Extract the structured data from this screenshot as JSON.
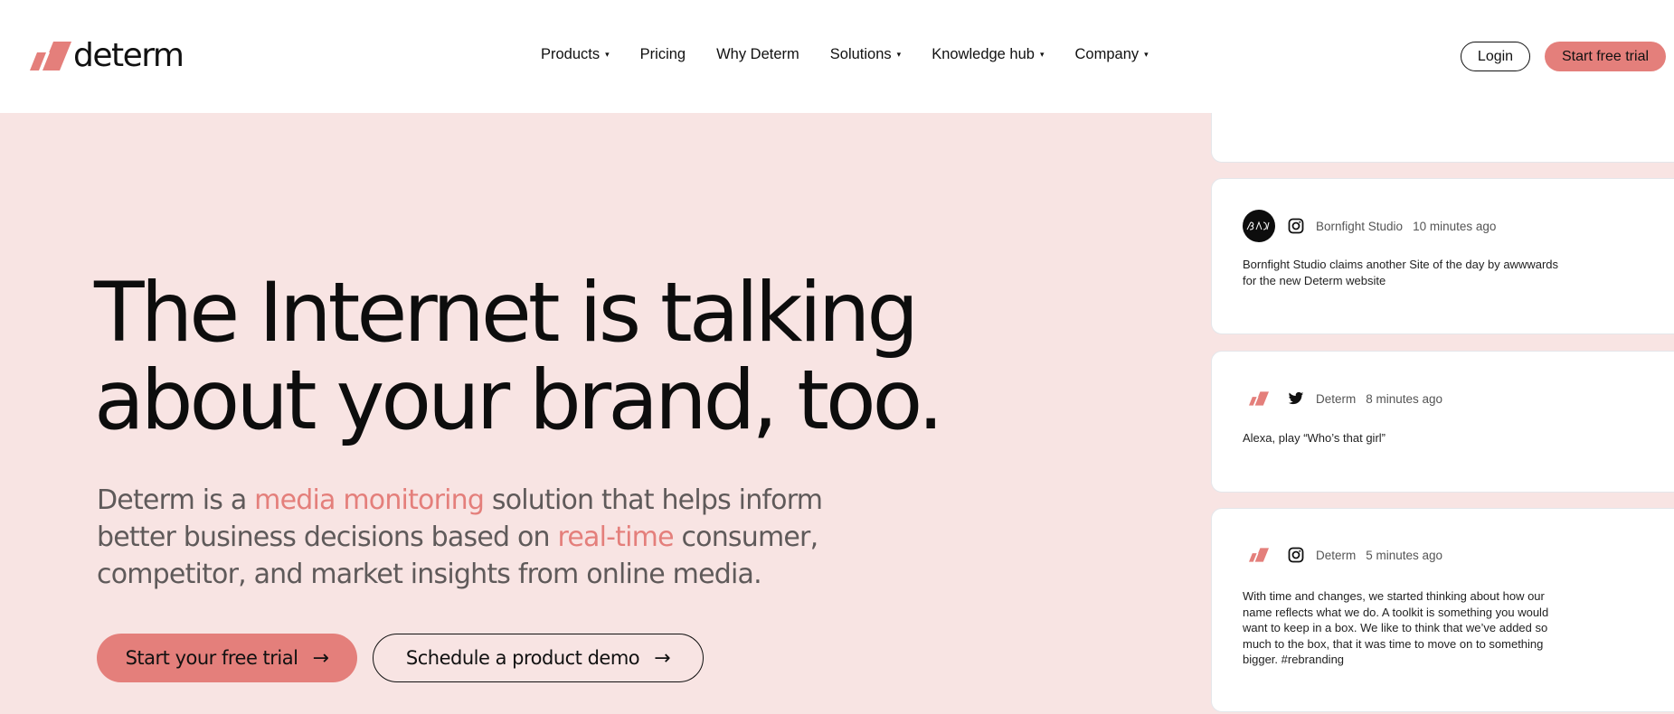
{
  "brand": {
    "name": "determ",
    "accent": "#e47f7b",
    "bg": "#f8e4e3"
  },
  "nav": {
    "items": [
      {
        "label": "Products",
        "dropdown": true
      },
      {
        "label": "Pricing",
        "dropdown": false
      },
      {
        "label": "Why Determ",
        "dropdown": false
      },
      {
        "label": "Solutions",
        "dropdown": true
      },
      {
        "label": "Knowledge hub",
        "dropdown": true
      },
      {
        "label": "Company",
        "dropdown": true
      }
    ],
    "caret": "▾",
    "login_label": "Login",
    "trial_label": "Start free trial"
  },
  "hero": {
    "headline_line1": "The Internet is talking",
    "headline_line2": "about your brand, too.",
    "sub_part1": "Determ is a ",
    "sub_hl1": "media monitoring",
    "sub_part2": " solution that helps inform better business decisions based on ",
    "sub_hl2": "real-time",
    "sub_part3": " consumer, competitor, and market insights from online media.",
    "cta_primary": "Start your free trial",
    "cta_secondary": "Schedule a product demo",
    "arrow": "→"
  },
  "feed": {
    "cards": [
      {
        "author": "",
        "time": "",
        "platform": "",
        "avatar": "",
        "text": ""
      },
      {
        "author": "Bornfight Studio",
        "time": "10 minutes ago",
        "platform": "instagram-icon",
        "avatar": "bornfight-logo",
        "text": "Bornfight Studio claims another Site of the day by awwwards for the new Determ website"
      },
      {
        "author": "Determ",
        "time": "8 minutes ago",
        "platform": "twitter-icon",
        "avatar": "determ-logo",
        "text": "Alexa, play “Who’s that girl”"
      },
      {
        "author": "Determ",
        "time": "5 minutes ago",
        "platform": "instagram-icon",
        "avatar": "determ-logo",
        "text": "With time and changes, we started thinking about how our name reflects what we do. A toolkit is something you would want to keep in a box. We like to think that we’ve added so much to the box, that it was time to move on to something bigger. #rebranding"
      }
    ]
  }
}
